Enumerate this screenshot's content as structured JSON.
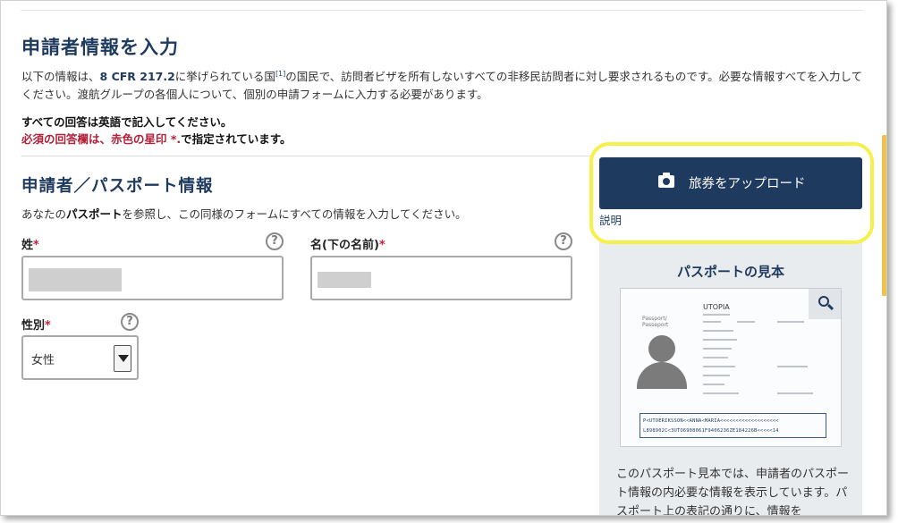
{
  "header": {
    "title": "申請者情報を入力"
  },
  "intro": {
    "part1": "以下の情報は、",
    "cfr": "8 CFR 217.2",
    "part2": "に挙げられている国",
    "footnote": "[1]",
    "part3": "の国民で、訪問者ビザを所有しないすべての非移民訪問者に対し要求されるものです。必要な情報すべてを入力してください。渡航グループの各個人について、個別の申請フォームに入力する必要があります。"
  },
  "notes": {
    "english": "すべての回答は英語で記入してください。",
    "required_red": "必須の回答欄は、赤色の星印 *.",
    "required_tail": "で指定されています。"
  },
  "section": {
    "title": "申請者／パスポート情報",
    "desc_pre": "あなたの",
    "desc_bold": "パスポート",
    "desc_post": "を参照し、この同様のフォームにすべての情報を入力してください。"
  },
  "fields": {
    "surname_label": "姓",
    "given_label": "名(下の名前)",
    "gender_label": "性別",
    "required_mark": "*",
    "help_glyph": "?",
    "gender_value": "女性"
  },
  "upload": {
    "button_label": "旅券をアップロード",
    "explain_link": "説明"
  },
  "sample": {
    "title": "パスポートの見本",
    "passport_country": "UTOPIA",
    "passport_header": "Passport/\nPasseport",
    "mrz_line1": "P<UTOERIKSSON<<ANNA<MARIA<<<<<<<<<<<<<<<<<<<",
    "mrz_line2": "L898902C<3UTO6908061F9406236ZE184226B<<<<<14",
    "description": "このパスポート見本では、申請者のパスポート情報の内必要な情報を表示しています。パスポート上の表記の通りに、情報を"
  },
  "colors": {
    "navy": "#1f3a5f",
    "required_red": "#c0223a",
    "highlight": "#f5f04a"
  }
}
